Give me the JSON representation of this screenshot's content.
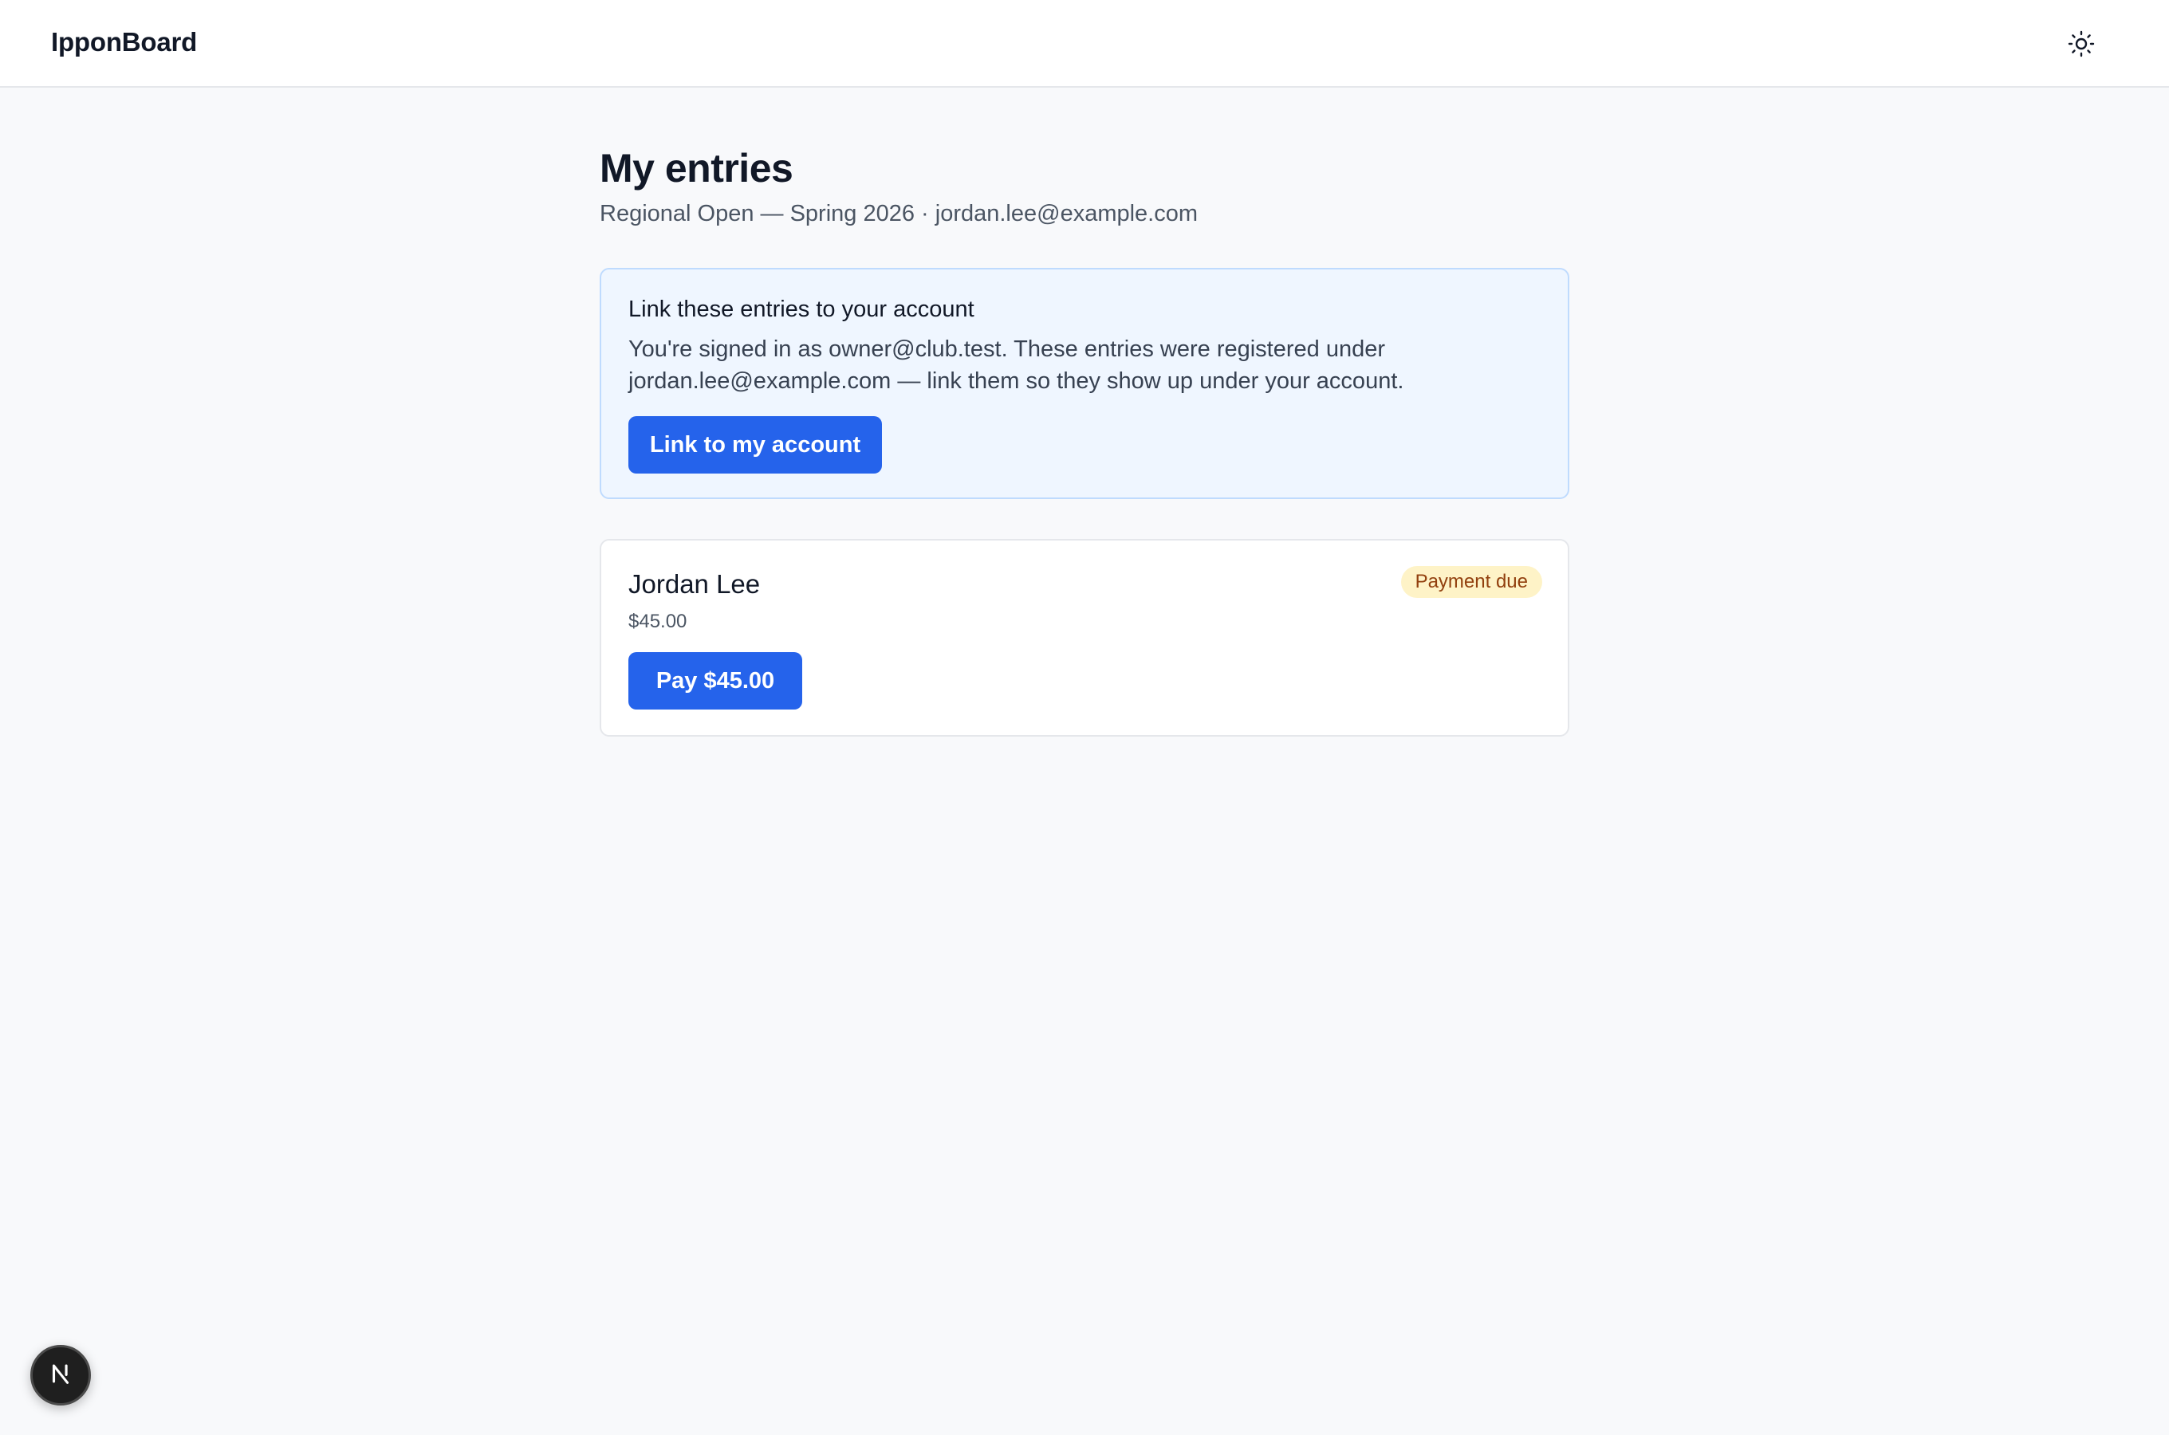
{
  "header": {
    "brand": "IpponBoard",
    "theme_toggle_icon": "sun-icon"
  },
  "page": {
    "title": "My entries",
    "subtitle": "Regional Open — Spring 2026 · jordan.lee@example.com"
  },
  "link_panel": {
    "title": "Link these entries to your account",
    "text": "You're signed in as owner@club.test. These entries were registered under jordan.lee@example.com — link them so they show up under your account.",
    "button_label": "Link to my account"
  },
  "entries": [
    {
      "name": "Jordan Lee",
      "amount": "$45.00",
      "status": "Payment due",
      "pay_label": "Pay $45.00"
    }
  ],
  "dev_badge": {
    "icon": "nextjs-icon",
    "letter": "N"
  },
  "colors": {
    "accent": "#2563eb",
    "panel_bg": "#eff6ff",
    "panel_border": "#bfdbfe",
    "badge_bg": "#fef3c7",
    "badge_text": "#92400e",
    "page_bg": "#f8f9fb"
  }
}
